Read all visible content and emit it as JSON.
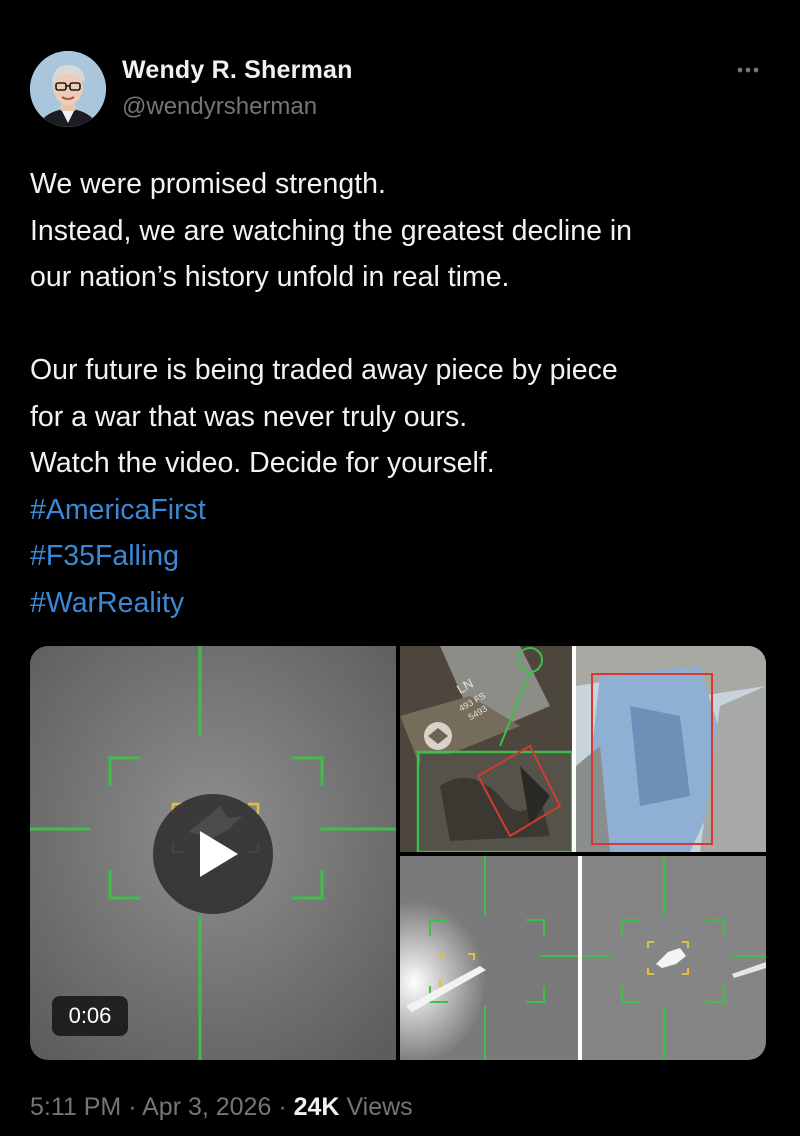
{
  "author": {
    "display_name": "Wendy R. Sherman",
    "handle": "@wendyrsherman",
    "avatar_icon": "profile-photo"
  },
  "more_icon": "more-horizontal-icon",
  "text": {
    "lines": [
      "We were promised strength.",
      "Instead, we are watching the greatest decline in",
      "our nation’s history unfold in real time."
    ],
    "lines2": [
      "Our future is being traded away piece by piece",
      "for a war that was never truly ours.",
      "Watch the video. Decide for yourself."
    ],
    "hashtags": [
      "#AmericaFirst",
      "#F35Falling",
      "#WarReality"
    ]
  },
  "media": {
    "video_duration": "0:06",
    "play_icon": "play-icon",
    "aircraft_tail_markings": [
      "LN",
      "493 FS",
      "5493"
    ]
  },
  "meta": {
    "time": "5:11 PM",
    "separator": "·",
    "date": "Apr 3, 2026",
    "views_count": "24K",
    "views_label": "Views"
  },
  "colors": {
    "background": "#000000",
    "text": "#e7e9ea",
    "secondary": "#71767b",
    "link": "#3b88d8",
    "reticle": "#3fbf4a"
  }
}
